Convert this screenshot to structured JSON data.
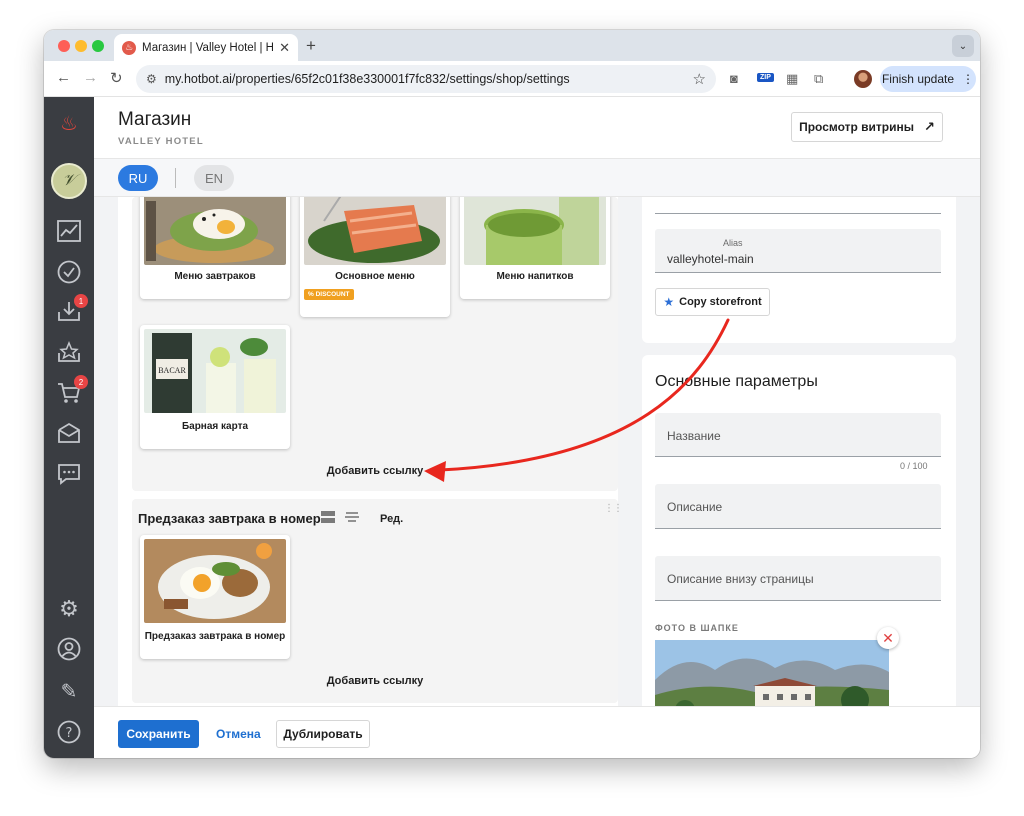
{
  "browser": {
    "tab_title": "Магазин | Valley Hotel | Hotbot",
    "url": "my.hotbot.ai/properties/65f2c01f38e330001f7fc832/settings/shop/settings",
    "ext_zip": "ZIP",
    "finish_update": "Finish update"
  },
  "sidebar": {
    "badges": {
      "downloads": "1",
      "cart": "2"
    }
  },
  "header": {
    "title": "Магазин",
    "subtitle": "VALLEY HOTEL",
    "preview_button": "Просмотр витрины"
  },
  "languages": {
    "ru": "RU",
    "en": "EN"
  },
  "section1": {
    "cards": [
      {
        "label": "Меню завтраков"
      },
      {
        "label": "Основное меню",
        "badge": "% DISCOUNT"
      },
      {
        "label": "Меню напитков"
      },
      {
        "label": "Барная карта"
      }
    ],
    "add_link": "Добавить ссылку"
  },
  "section2": {
    "title": "Предзаказ завтрака в номер",
    "edit_label": "Ред.",
    "cards": [
      {
        "label": "Предзаказ завтрака в номер"
      }
    ],
    "add_link": "Добавить ссылку"
  },
  "storefront": {
    "alias_label": "Alias",
    "alias_value": "valleyhotel-main",
    "copy_button": "Copy storefront"
  },
  "params": {
    "title": "Основные параметры",
    "name_label": "Название",
    "name_counter": "0 / 100",
    "description_label": "Описание",
    "footer_description_label": "Описание внизу страницы",
    "header_photo_label": "ФОТО В ШАПКЕ"
  },
  "footer": {
    "save": "Сохранить",
    "cancel": "Отмена",
    "duplicate": "Дублировать"
  },
  "colors": {
    "accent": "#1e6fd0",
    "lang_active": "#2c7ae0",
    "sidebar": "#3a3d42",
    "badge": "#e84545",
    "discount": "#f0a020",
    "annotation_arrow": "#e8271e"
  }
}
